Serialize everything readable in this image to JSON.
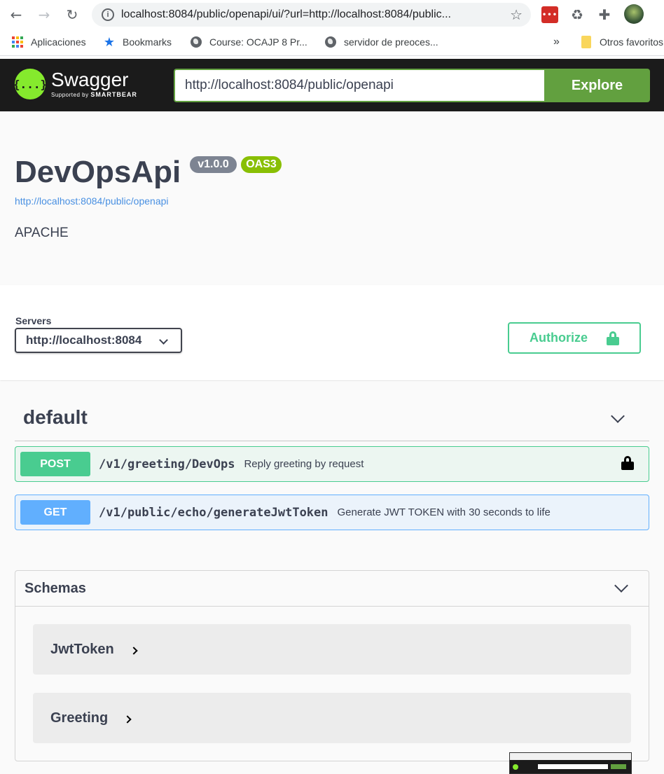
{
  "browser": {
    "url": "localhost:8084/public/openapi/ui/?url=http://localhost:8084/public...",
    "nav": {
      "back": "←",
      "forward": "→",
      "reload": "↻"
    },
    "star_icon": "☆",
    "extensions": {
      "lastpass": "•••",
      "recycle": "♻",
      "puzzle": "✚"
    },
    "bookmarks": [
      {
        "label": "Aplicaciones",
        "icon": "apps-grid-icon"
      },
      {
        "label": "Bookmarks",
        "icon": "star-icon"
      },
      {
        "label": "Course: OCAJP 8 Pr...",
        "icon": "globe-icon"
      },
      {
        "label": "servidor de preoces...",
        "icon": "globe-icon"
      }
    ],
    "overflow": "»",
    "other_bookmarks": "Otros favoritos"
  },
  "swagger": {
    "logo_title": "Swagger",
    "logo_sub_prefix": "Supported by",
    "logo_sub_brand": "SMARTBEAR",
    "logo_symbol": "{...}",
    "url_value": "http://localhost:8084/public/openapi",
    "explore_label": "Explore"
  },
  "info": {
    "title": "DevOpsApi",
    "version": "v1.0.0",
    "oas": "OAS3",
    "url": "http://localhost:8084/public/openapi",
    "description": "APACHE"
  },
  "servers": {
    "label": "Servers",
    "selected": "http://localhost:8084",
    "authorize_label": "Authorize"
  },
  "tag": {
    "name": "default",
    "operations": [
      {
        "method": "POST",
        "path": "/v1/greeting/DevOps",
        "summary": "Reply greeting by request",
        "locked": true
      },
      {
        "method": "GET",
        "path": "/v1/public/echo/generateJwtToken",
        "summary": "Generate JWT TOKEN with 30 seconds to life",
        "locked": false
      }
    ]
  },
  "schemas": {
    "title": "Schemas",
    "items": [
      "JwtToken",
      "Greeting"
    ]
  },
  "colors": {
    "post": "#49cc90",
    "get": "#61affe",
    "explore": "#62a03f",
    "logo": "#85ea2d"
  }
}
